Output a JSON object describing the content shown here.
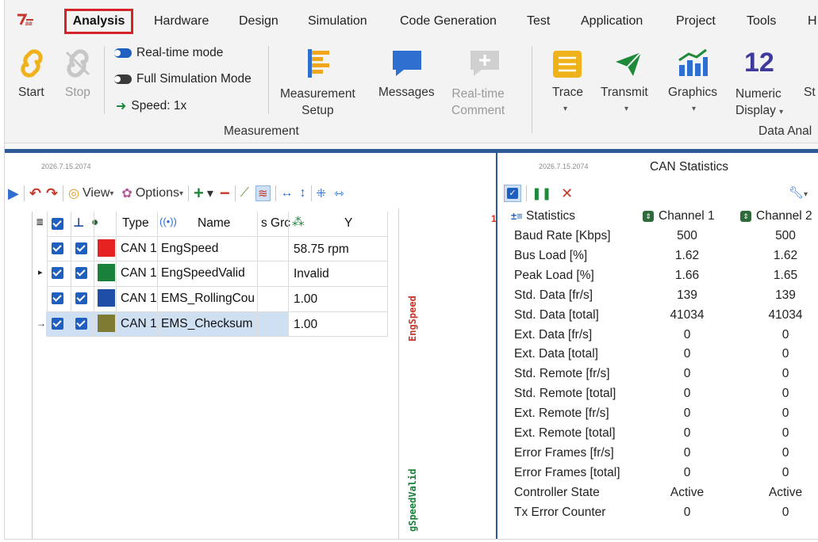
{
  "menu": {
    "logo": "7/ԑ",
    "active": "Analysis",
    "items": [
      "Hardware",
      "Design",
      "Simulation",
      "Code Generation",
      "Test",
      "Application",
      "Project",
      "Tools",
      "H"
    ]
  },
  "ribbon": {
    "start": "Start",
    "stop": "Stop",
    "realtime_mode": "Real-time mode",
    "full_sim_mode": "Full Simulation Mode",
    "speed": "Speed: 1x",
    "measurement_setup": [
      "Measurement",
      "Setup"
    ],
    "messages": "Messages",
    "realtime_comment": [
      "Real-time",
      "Comment"
    ],
    "trace": "Trace",
    "transmit": "Transmit",
    "graphics": "Graphics",
    "numeric_display": [
      "Numeric",
      "Display"
    ],
    "numeric_icon": "12",
    "cut_label": "St",
    "group_measurement": "Measurement",
    "group_data_analysis": "Data Anal"
  },
  "left_pane": {
    "title": "2026.7.15.2074",
    "toolbar": {
      "view": "View",
      "options": "Options"
    },
    "columns": {
      "type": "Type",
      "name": "Name",
      "group": "s Grc",
      "y": "Y"
    },
    "rows": [
      {
        "type": "CAN 1",
        "name": "EngSpeed",
        "value": "58.75 rpm",
        "color": "#e52421",
        "marker": ""
      },
      {
        "type": "CAN 1",
        "name": "EngSpeedValid",
        "value": "Invalid",
        "color": "#19813a",
        "marker": "▸"
      },
      {
        "type": "CAN 1",
        "name": "EMS_RollingCou",
        "value": "1.00",
        "color": "#1f4ea6",
        "marker": ""
      },
      {
        "type": "CAN 1",
        "name": "EMS_Checksum",
        "value": "1.00",
        "color": "#7f7b33",
        "marker": "→"
      }
    ],
    "graph_labels": {
      "a": "EngSpeed",
      "b": "gSpeedValid",
      "tick": "1"
    }
  },
  "right_pane": {
    "title_small": "2026.7.15.2074",
    "title": "CAN Statistics",
    "header": {
      "statistics": "Statistics",
      "ch1": "Channel 1",
      "ch2": "Channel 2"
    },
    "rows": [
      {
        "label": "Baud Rate [Kbps]",
        "c1": "500",
        "c2": "500"
      },
      {
        "label": "Bus Load [%]",
        "c1": "1.62",
        "c2": "1.62"
      },
      {
        "label": "Peak Load [%]",
        "c1": "1.66",
        "c2": "1.65"
      },
      {
        "label": "Std. Data [fr/s]",
        "c1": "139",
        "c2": "139"
      },
      {
        "label": "Std. Data [total]",
        "c1": "41034",
        "c2": "41034"
      },
      {
        "label": "Ext. Data [fr/s]",
        "c1": "0",
        "c2": "0"
      },
      {
        "label": "Ext. Data [total]",
        "c1": "0",
        "c2": "0"
      },
      {
        "label": "Std. Remote [fr/s]",
        "c1": "0",
        "c2": "0"
      },
      {
        "label": "Std. Remote [total]",
        "c1": "0",
        "c2": "0"
      },
      {
        "label": "Ext. Remote [fr/s]",
        "c1": "0",
        "c2": "0"
      },
      {
        "label": "Ext. Remote [total]",
        "c1": "0",
        "c2": "0"
      },
      {
        "label": "Error Frames [fr/s]",
        "c1": "0",
        "c2": "0"
      },
      {
        "label": "Error Frames [total]",
        "c1": "0",
        "c2": "0"
      },
      {
        "label": "Controller State",
        "c1": "Active",
        "c2": "Active"
      },
      {
        "label": "Tx Error Counter",
        "c1": "0",
        "c2": "0"
      }
    ]
  }
}
